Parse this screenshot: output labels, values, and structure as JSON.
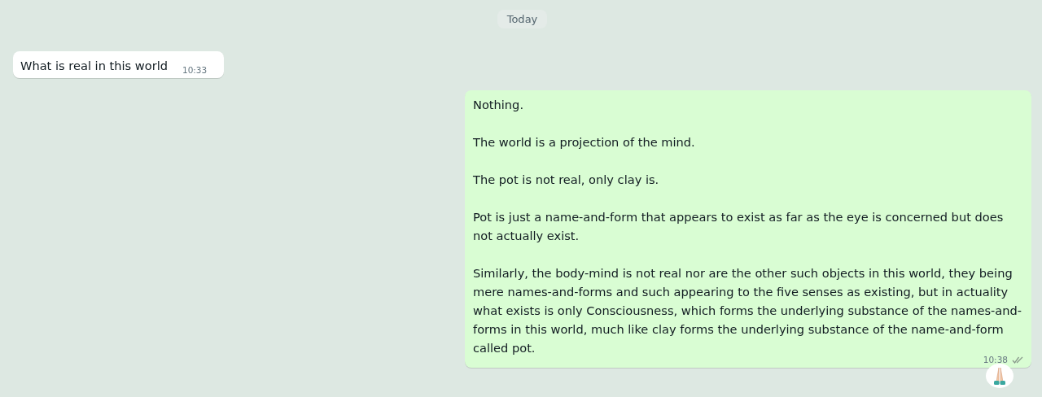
{
  "date_chip": "Today",
  "messages": [
    {
      "kind": "incoming",
      "paragraphs": [
        "What is real in this world"
      ],
      "time": "10:33"
    },
    {
      "kind": "outgoing",
      "paragraphs": [
        "Nothing.",
        "The world is a projection of the mind.",
        "The pot is not real, only clay is.",
        "Pot is just a name-and-form that appears to exist as far as the eye is concerned but does not actually exist.",
        "Similarly, the body-mind is not real nor are the other such objects in this world, they being mere names-and-forms and such appearing to the five senses as existing, but in actuality what exists is only Consciousness, which forms the underlying substance of the names-and-forms in this world, much like clay forms the underlying substance of the name-and-form called pot."
      ],
      "time": "10:38",
      "read": false,
      "reaction": true
    }
  ]
}
